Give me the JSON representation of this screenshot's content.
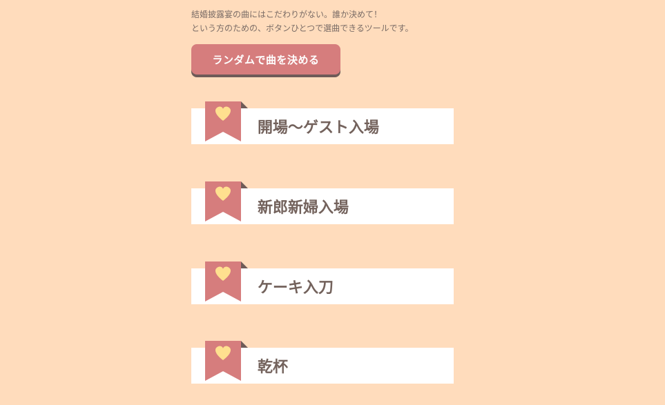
{
  "intro": {
    "line1": "結婚披露宴の曲にはこだわりがない。誰か決めて！",
    "line2": "という方のための、ボタンひとつで選曲できるツールです。"
  },
  "random_button": {
    "label": "ランダムで曲を決める"
  },
  "scenes": [
    {
      "label": "開場〜ゲスト入場",
      "icon": "heart-ribbon-icon"
    },
    {
      "label": "新郎新婦入場",
      "icon": "heart-ribbon-icon"
    },
    {
      "label": "ケーキ入刀",
      "icon": "heart-ribbon-icon"
    },
    {
      "label": "乾杯",
      "icon": "heart-ribbon-icon"
    }
  ],
  "colors": {
    "background": "#ffdcbc",
    "accent": "#d67d7d",
    "button_shadow": "#6e5b58",
    "heart": "#ffe08f",
    "text": "#73625c"
  }
}
